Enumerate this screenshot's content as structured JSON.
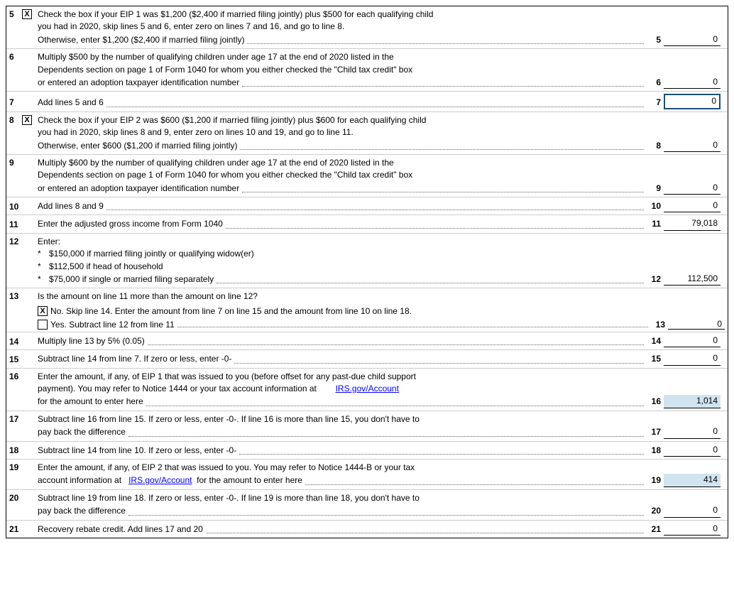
{
  "lines": {
    "line5": {
      "num": "5",
      "checked": true,
      "text1": "Check the box if your EIP 1 was $1,200 ($2,400 if married filing jointly) plus $500 for each qualifying child",
      "text2": "you had in 2020, skip lines 5 and 6, enter zero on lines 7 and 16, and go to line 8.",
      "text3": "Otherwise, enter $1,200 ($2,400 if married filing jointly)",
      "field_label": "5",
      "value": "0"
    },
    "line6": {
      "num": "6",
      "text1": "Multiply $500 by the number of qualifying children under age 17 at the end of 2020 listed in the",
      "text2": "Dependents section on page 1 of Form 1040 for whom you either checked the \"Child tax credit\" box",
      "text3": "or entered an adoption taxpayer identification number",
      "field_label": "6",
      "value": "0"
    },
    "line7": {
      "num": "7",
      "text1": "Add lines 5 and 6",
      "field_label": "7",
      "value": "0"
    },
    "line8": {
      "num": "8",
      "checked": true,
      "text1": "Check the box if your EIP 2 was $600 ($1,200 if married filing jointly) plus $600 for each qualifying child",
      "text2": "you had in 2020, skip lines 8 and 9, enter zero on lines 10 and 19, and go to line 11.",
      "text3": "Otherwise, enter $600 ($1,200 if married filing jointly)",
      "field_label": "8",
      "value": "0"
    },
    "line9": {
      "num": "9",
      "text1": "Multiply $600 by the number of qualifying children under age 17 at the end of 2020 listed in the",
      "text2": "Dependents section on page 1 of Form 1040 for whom you either checked the \"Child tax credit\" box",
      "text3": "or entered an adoption taxpayer identification number",
      "field_label": "9",
      "value": "0"
    },
    "line10": {
      "num": "10",
      "text1": "Add lines 8 and 9",
      "field_label": "10",
      "value": "0"
    },
    "line11": {
      "num": "11",
      "text1": "Enter the adjusted gross income from Form 1040",
      "field_label": "11",
      "value": "79,018"
    },
    "line12": {
      "num": "12",
      "label": "Enter:",
      "bullet1": "$150,000 if married filing jointly or qualifying widow(er)",
      "bullet2": "$112,500 if head of household",
      "bullet3": "$75,000 if single or married filing separately",
      "field_label": "12",
      "value": "112,500"
    },
    "line13": {
      "num": "13",
      "question": "Is the amount on line 11 more than the amount on line 12?",
      "no_checked": true,
      "no_text": "No. Skip line 14. Enter the amount from line 7 on line 15 and the amount from line 10 on line 18.",
      "yes_checked": false,
      "yes_text": "Yes. Subtract line 12 from line 11",
      "field_label": "13",
      "value": "0"
    },
    "line14": {
      "num": "14",
      "text1": "Multiply line 13 by 5% (0.05)",
      "field_label": "14",
      "value": "0"
    },
    "line15": {
      "num": "15",
      "text1": "Subtract line 14 from line 7. If zero or less, enter  -0-",
      "field_label": "15",
      "value": "0"
    },
    "line16": {
      "num": "16",
      "text1": "Enter the amount, if any, of EIP 1 that was issued to you (before offset for any past-due child support",
      "text2": "payment). You may refer to Notice 1444 or your tax account information at",
      "link_text": "IRS.gov/Account",
      "text3": "for the amount to enter here",
      "field_label": "16",
      "value": "1,014",
      "highlighted": true
    },
    "line17": {
      "num": "17",
      "text1": "Subtract line 16 from line 15. If zero or less, enter -0-. If line 16 is more than line 15, you don't have to",
      "text2": "pay back the difference",
      "field_label": "17",
      "value": "0"
    },
    "line18": {
      "num": "18",
      "text1": "Subtract line 14 from line 10. If zero or less, enter -0-",
      "field_label": "18",
      "value": "0"
    },
    "line19": {
      "num": "19",
      "text1": "Enter the amount, if any, of EIP 2 that was issued to you. You may refer to Notice 1444-B or your tax",
      "text2": "account information at",
      "link_text": "IRS.gov/Account",
      "text3": "for the amount to enter here",
      "field_label": "19",
      "value": "414",
      "highlighted": true
    },
    "line20": {
      "num": "20",
      "text1": "Subtract line 19 from line 18. If zero or less, enter -0-. If line 19 is more than line 18, you don't have to",
      "text2": "pay back the difference",
      "field_label": "20",
      "value": "0"
    },
    "line21": {
      "num": "21",
      "text1": "Recovery rebate credit. Add lines 17 and 20",
      "field_label": "21",
      "value": "0"
    }
  }
}
